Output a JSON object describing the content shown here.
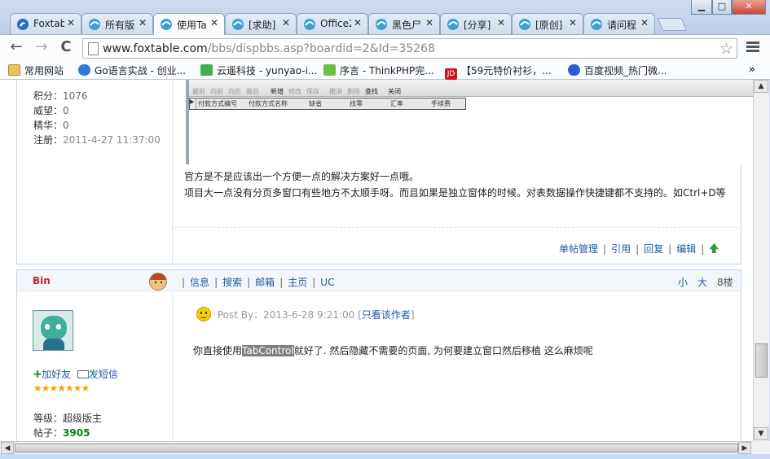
{
  "colors": {
    "accent": "#1d5aa5",
    "highlight": "#808080",
    "username": "#c0262d",
    "posts_count": "#0a7a1a"
  },
  "window_controls": {
    "minimize": "▁",
    "maximize": "□",
    "close": "✕"
  },
  "tabs": [
    {
      "title": "Foxtab",
      "icon": "foxtable-favicon",
      "active": false
    },
    {
      "title": "所有版",
      "icon": "foxtable-favicon",
      "active": false
    },
    {
      "title": "使用Ta",
      "icon": "foxtable-favicon",
      "active": true
    },
    {
      "title": "[求助]",
      "icon": "page-icon",
      "active": false
    },
    {
      "title": "Office2",
      "icon": "page-icon",
      "active": false
    },
    {
      "title": "黑色尸",
      "icon": "page-icon",
      "active": false
    },
    {
      "title": "[分享]",
      "icon": "page-icon",
      "active": false
    },
    {
      "title": "[原创]",
      "icon": "page-icon",
      "active": false
    },
    {
      "title": "请问程",
      "icon": "foxtable-favicon",
      "active": false
    }
  ],
  "nav": {
    "back": "←",
    "forward": "→",
    "reload": "C",
    "url_host": "www.foxtable.com",
    "url_path": "/bbs/dispbbs.asp?boardid=2&Id=35268"
  },
  "bookmarks": [
    {
      "label": "常用网站",
      "icon": "folder-icon"
    },
    {
      "label": "Go语言实战 - 创业...",
      "icon": "go-icon"
    },
    {
      "label": "云遥科技 - yunyao-i...",
      "icon": "cloud-icon"
    },
    {
      "label": "序言 - ThinkPHP完...",
      "icon": "leaf-icon"
    },
    {
      "label": "【59元特价衬衫，...",
      "icon": "jd-icon"
    },
    {
      "label": "百度视频_热门微...",
      "icon": "baidu-icon"
    }
  ],
  "bookmarks_more": "»",
  "post1": {
    "user_stats": [
      {
        "label": "积分：",
        "value": "1076"
      },
      {
        "label": "威望：",
        "value": "0"
      },
      {
        "label": "精华：",
        "value": "0"
      },
      {
        "label": "注册：",
        "value": "2011-4-27 11:37:00"
      }
    ],
    "screenshot": {
      "toolbar_buttons": [
        "最前",
        "向前",
        "向后",
        "最后",
        "新增",
        "修改",
        "保存",
        "撤消",
        "删除",
        "查找",
        "关闭"
      ],
      "grid_columns": [
        "付款方式编号",
        "付款方式名称",
        "缺省",
        "找零",
        "汇率",
        "手续费"
      ]
    },
    "body_lines": [
      "官方是不是应该出一个方便一点的解决方案好一点哦。",
      "项目大一点没有分页多窗口有些地方不太顺手呀。而且如果是独立窗体的时候。对表数据操作快捷键都不支持的。如Ctrl+D等"
    ],
    "footer_links": [
      "单帖管理",
      "引用",
      "回复",
      "编辑"
    ],
    "footer_sep": "|",
    "top_icon": "up-arrow-icon"
  },
  "post2": {
    "username": "Bin",
    "header_links": [
      "信息",
      "搜索",
      "邮箱",
      "主页",
      "UC"
    ],
    "font_small": "小",
    "font_large": "大",
    "floor": "8楼",
    "post_by_label": "Post By：",
    "post_time": "2013-6-28 9:21:00",
    "view_author": "只看该作者",
    "body_pre": "你直接使用",
    "body_highlight": "TabControl",
    "body_post": "就好了. 然后隐藏不需要的页面, 为何要建立窗口然后移植 这么麻烦呢",
    "add_friend": "加好友",
    "send_message": "发短信",
    "stars": "★★★★★★★",
    "level_label": "等级：",
    "level_value": "超级版主",
    "posts_label": "帖子：",
    "posts_value": "3905"
  }
}
